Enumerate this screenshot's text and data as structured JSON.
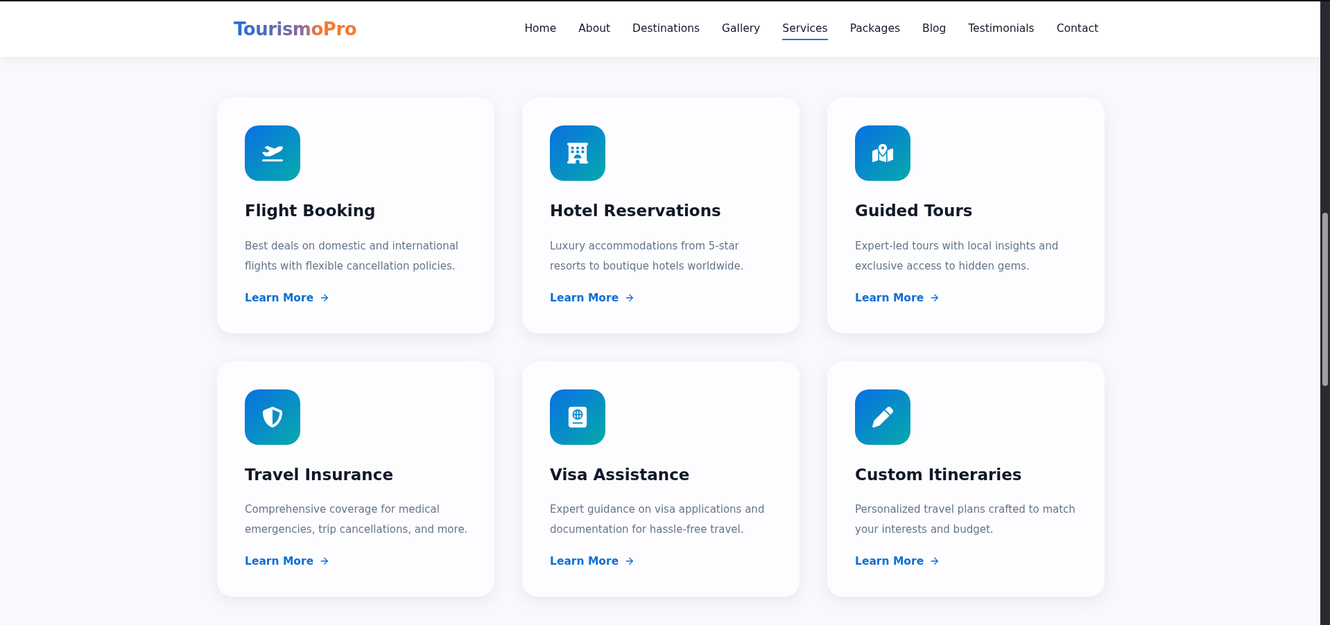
{
  "logo": {
    "first": "Tourismo",
    "second": "Pro"
  },
  "nav": [
    {
      "label": "Home",
      "selected": false
    },
    {
      "label": "About",
      "selected": false
    },
    {
      "label": "Destinations",
      "selected": false
    },
    {
      "label": "Gallery",
      "selected": false
    },
    {
      "label": "Services",
      "selected": true
    },
    {
      "label": "Packages",
      "selected": false
    },
    {
      "label": "Blog",
      "selected": false
    },
    {
      "label": "Testimonials",
      "selected": false
    },
    {
      "label": "Contact",
      "selected": false
    }
  ],
  "services": [
    {
      "kind": "plane",
      "title": "Flight Booking",
      "description": "Best deals on domestic and international flights with flexible cancellation policies.",
      "link": "Learn More"
    },
    {
      "kind": "hotel",
      "title": "Hotel Reservations",
      "description": "Luxury accommodations from 5-star resorts to boutique hotels worldwide.",
      "link": "Learn More"
    },
    {
      "kind": "map",
      "title": "Guided Tours",
      "description": "Expert-led tours with local insights and exclusive access to hidden gems.",
      "link": "Learn More"
    },
    {
      "kind": "shield",
      "title": "Travel Insurance",
      "description": "Comprehensive coverage for medical emergencies, trip cancellations, and more.",
      "link": "Learn More"
    },
    {
      "kind": "passport",
      "title": "Visa Assistance",
      "description": "Expert guidance on visa applications and documentation for hassle-free travel.",
      "link": "Learn More"
    },
    {
      "kind": "pen",
      "title": "Custom Itineraries",
      "description": "Personalized travel plans crafted to match your interests and budget.",
      "link": "Learn More"
    }
  ]
}
